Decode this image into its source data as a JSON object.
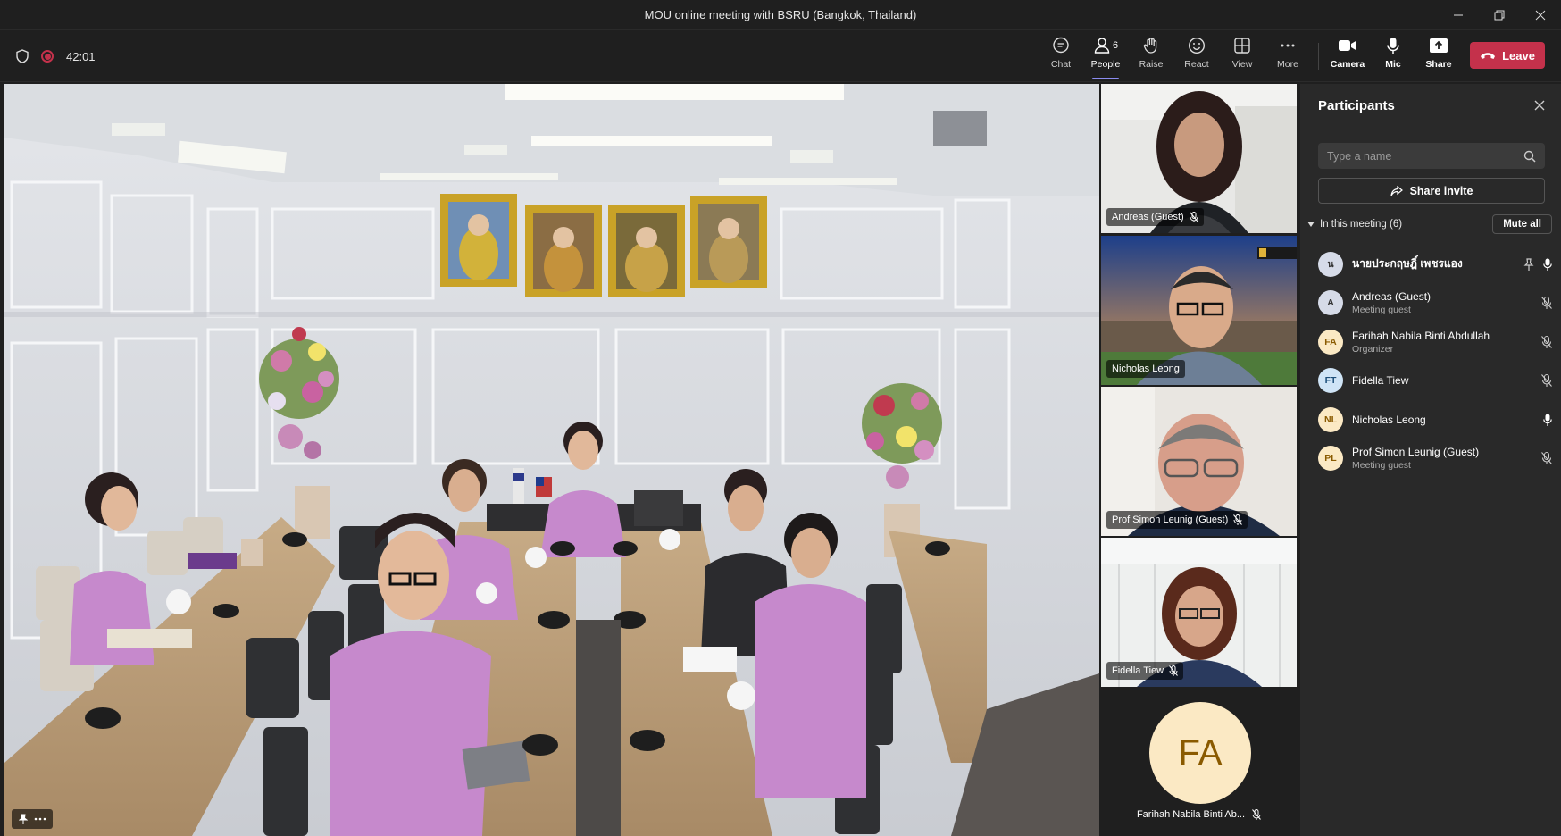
{
  "window": {
    "title": "MOU online meeting with BSRU (Bangkok, Thailand)"
  },
  "toolbar": {
    "timer": "42:01",
    "chat": "Chat",
    "people": "People",
    "people_count": "6",
    "raise": "Raise",
    "react": "React",
    "view": "View",
    "more": "More",
    "camera": "Camera",
    "mic": "Mic",
    "share": "Share",
    "leave": "Leave"
  },
  "tiles": [
    {
      "name": "Andreas (Guest)"
    },
    {
      "name": "Nicholas Leong"
    },
    {
      "name": "Prof Simon Leunig (Guest)"
    },
    {
      "name": "Fidella Tiew"
    }
  ],
  "avatar_tile": {
    "initials": "FA",
    "name": "Farihah Nabila Binti Ab..."
  },
  "participants_panel": {
    "title": "Participants",
    "search_placeholder": "Type a name",
    "share_invite": "Share invite",
    "section_label": "In this meeting (6)",
    "mute_all": "Mute all",
    "people": [
      {
        "initials": "น",
        "name": "นายประกฤษฎิ์ เพชรแอง",
        "role": "",
        "avatar_color": "#d6dbe8",
        "mic": "on",
        "pinned": true
      },
      {
        "initials": "A",
        "name": "Andreas (Guest)",
        "role": "Meeting guest",
        "avatar_color": "#d6dbe8",
        "mic": "off",
        "pinned": false
      },
      {
        "initials": "FA",
        "name": "Farihah Nabila Binti Abdullah",
        "role": "Organizer",
        "avatar_color": "#fbe9c4",
        "mic": "off",
        "pinned": false
      },
      {
        "initials": "FT",
        "name": "Fidella Tiew",
        "role": "",
        "avatar_color": "#cfe4f6",
        "mic": "off",
        "pinned": false
      },
      {
        "initials": "NL",
        "name": "Nicholas Leong",
        "role": "",
        "avatar_color": "#fbe9c4",
        "mic": "on",
        "pinned": false
      },
      {
        "initials": "PL",
        "name": "Prof Simon Leunig (Guest)",
        "role": "Meeting guest",
        "avatar_color": "#fbe9c4",
        "mic": "off",
        "pinned": false
      }
    ]
  }
}
